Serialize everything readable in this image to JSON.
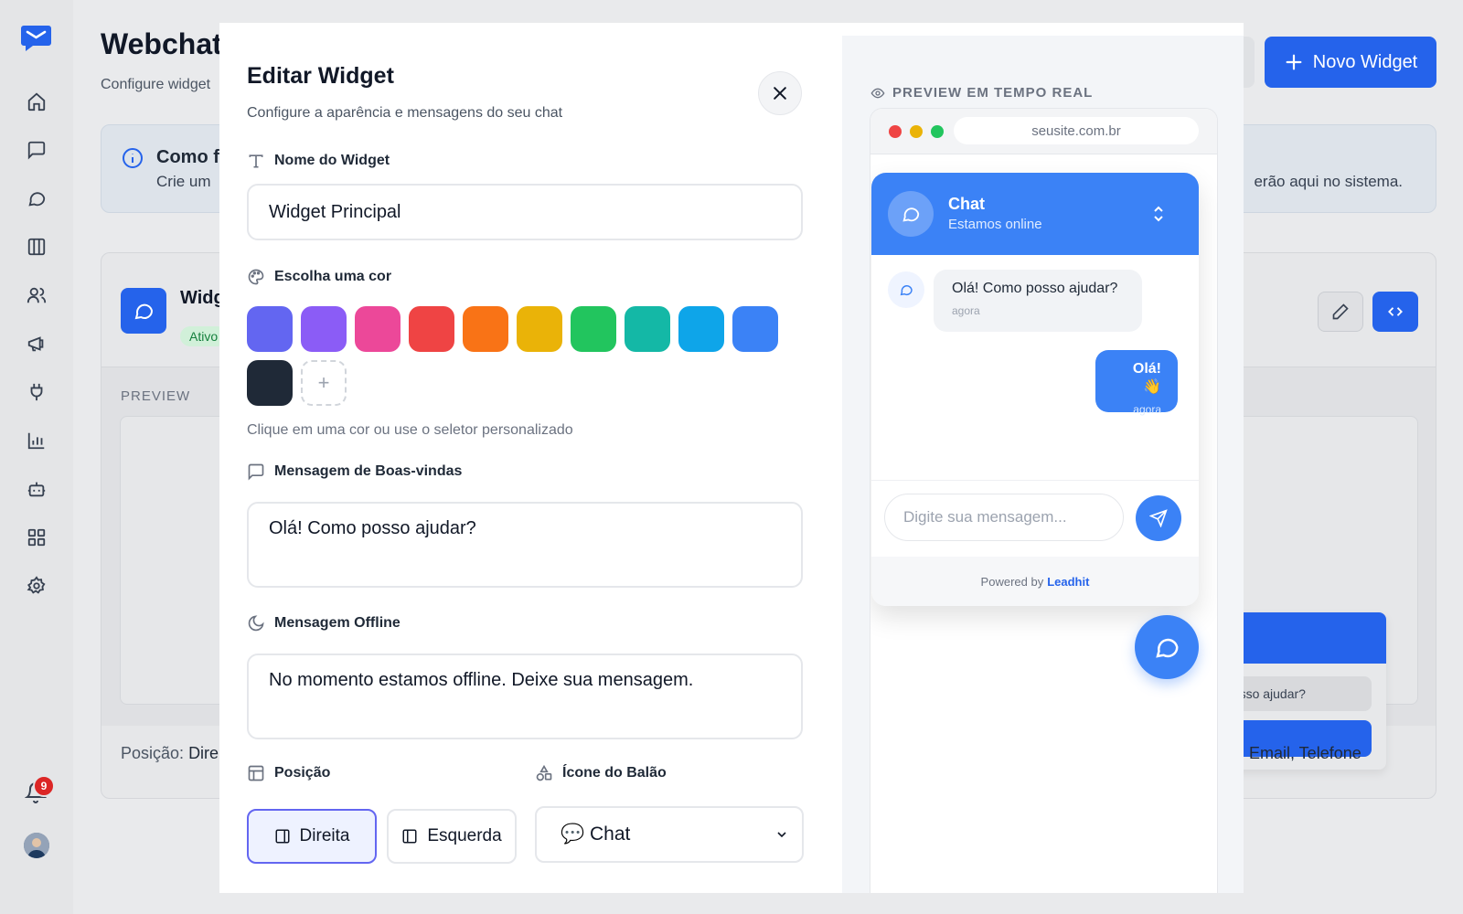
{
  "app": {
    "page_title": "Webchat",
    "page_subtitle": "Configure widget",
    "new_widget_label": "Novo Widget",
    "notification_count": "9"
  },
  "sidebar": {
    "items": [
      "home-icon",
      "message-square-icon",
      "message-circle-icon",
      "columns-icon",
      "users-icon",
      "megaphone-icon",
      "plug-icon",
      "bar-chart-icon",
      "bot-icon",
      "grid-icon",
      "settings-icon"
    ]
  },
  "info": {
    "title": "Como f",
    "text": "Crie um",
    "text_right": "erão aqui no sistema."
  },
  "widget_card": {
    "name": "Widg",
    "status": "Ativo",
    "preview_label": "PREVIEW",
    "mini_message": "posso ajudar?",
    "footer_label": "Posição:",
    "footer_value": "Dire",
    "footer_right": "Email, Telefone"
  },
  "modal": {
    "title": "Editar Widget",
    "subtitle": "Configure a aparência e mensagens do seu chat",
    "name_label": "Nome do Widget",
    "name_value": "Widget Principal",
    "color_label": "Escolha uma cor",
    "colors": [
      "#6366f1",
      "#8b5cf6",
      "#ec4899",
      "#ef4444",
      "#f97316",
      "#eab308",
      "#22c55e",
      "#14b8a6",
      "#0ea5e9",
      "#3b82f6",
      "#1f2937"
    ],
    "color_hint": "Clique em uma cor ou use o seletor personalizado",
    "welcome_label": "Mensagem de Boas-vindas",
    "welcome_value": "Olá! Como posso ajudar?",
    "offline_label": "Mensagem Offline",
    "offline_value": "No momento estamos offline. Deixe sua mensagem.",
    "position_label": "Posição",
    "position_right": "Direita",
    "position_left": "Esquerda",
    "icon_label": "Ícone do Balão",
    "icon_value": "💬 Chat"
  },
  "preview": {
    "label": "PREVIEW EM TEMPO REAL",
    "url": "seusite.com.br",
    "chat_title": "Chat",
    "chat_status": "Estamos online",
    "bot_message": "Olá! Como posso ajudar?",
    "bot_time": "agora",
    "user_message": "Olá! 👋",
    "user_time": "agora",
    "input_placeholder": "Digite sua mensagem...",
    "powered_by": "Powered by",
    "brand": "Leadhit"
  }
}
